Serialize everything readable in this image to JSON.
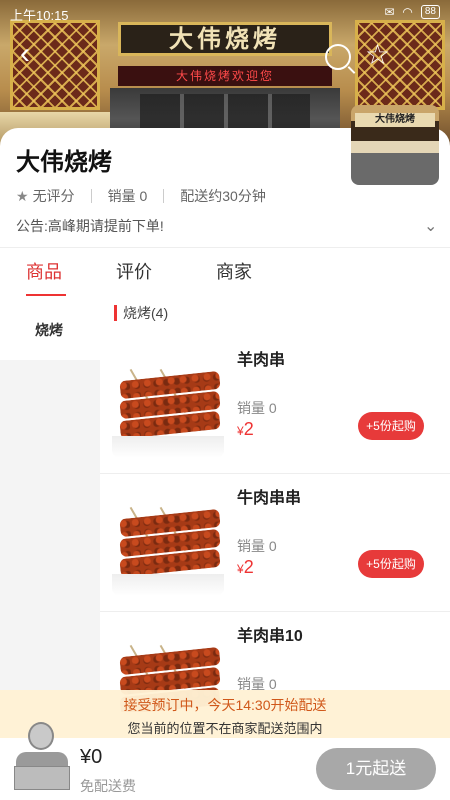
{
  "status_bar": {
    "time": "上午10:15",
    "battery": "88"
  },
  "banner": {
    "sign_text": "大伟烧烤",
    "scroll_text": "大伟烧烤欢迎您",
    "logo_text": "大伟烧烤"
  },
  "shop": {
    "name": "大伟烧烤",
    "rating": "无评分",
    "sales": "销量 0",
    "delivery": "配送约30分钟",
    "notice": "公告:高峰期请提前下单!"
  },
  "tabs": [
    {
      "label": "商品"
    },
    {
      "label": "评价"
    },
    {
      "label": "商家"
    }
  ],
  "categories": [
    {
      "label": "烧烤"
    }
  ],
  "section_title": "烧烤(4)",
  "products": [
    {
      "name": "羊肉串",
      "sales": "销量 0",
      "currency": "¥",
      "price": "2",
      "min_label": "+5份起购"
    },
    {
      "name": "牛肉串串",
      "sales": "销量 0",
      "currency": "¥",
      "price": "2",
      "min_label": "+5份起购"
    },
    {
      "name": "羊肉串10",
      "sales": "销量 0"
    }
  ],
  "preorder": {
    "line1": "接受预订中，今天14:30开始配送",
    "line2": "您当前的位置不在商家配送范围内"
  },
  "cart": {
    "total": "¥0",
    "shipping": "免配送费",
    "checkout_label": "1元起送"
  },
  "colors": {
    "accent": "#e73a3a",
    "disabled_button": "#a8a8a8"
  }
}
